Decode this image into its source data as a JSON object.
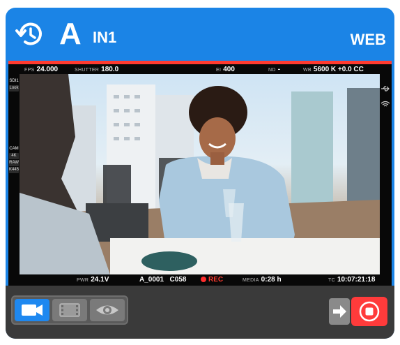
{
  "header": {
    "camera_letter": "A",
    "input": "IN1",
    "mode": "WEB",
    "sync_icon": "sync-clock-icon"
  },
  "monitor": {
    "top": {
      "fps_label": "FPS",
      "fps_value": "24.000",
      "shutter_label": "SHUTTER",
      "shutter_value": "180.0",
      "ei_label": "EI",
      "ei_value": "400",
      "nd_label": "ND",
      "nd_value": "-",
      "wb_label": "WB",
      "wb_value": "5600 K +0.0 CC"
    },
    "bottom": {
      "pwr_label": "PWR",
      "pwr_value": "24.1V",
      "clip": "A_0001",
      "clip_num": "C058",
      "rec": "REC",
      "media_label": "MEDIA",
      "media_value": "0:28 h",
      "tc_label": "TC",
      "tc_value": "10:07:21:18"
    },
    "left_tags": {
      "sdi": "SDI1",
      "look": "Look",
      "cam": "CAM",
      "res": "4K",
      "format": "RAW",
      "codec": "K445"
    },
    "right_icons": [
      "usb-icon",
      "wifi-icon"
    ]
  },
  "controls": {
    "buttons": [
      "video-camera-icon",
      "film-strip-icon",
      "eye-icon"
    ],
    "active": "video-camera-icon",
    "arrow": "arrow-right-icon",
    "stop": "stop-record-icon"
  },
  "colors": {
    "accent": "#1b84e6",
    "record": "#ff3b30",
    "panel": "#3a3a3a"
  }
}
